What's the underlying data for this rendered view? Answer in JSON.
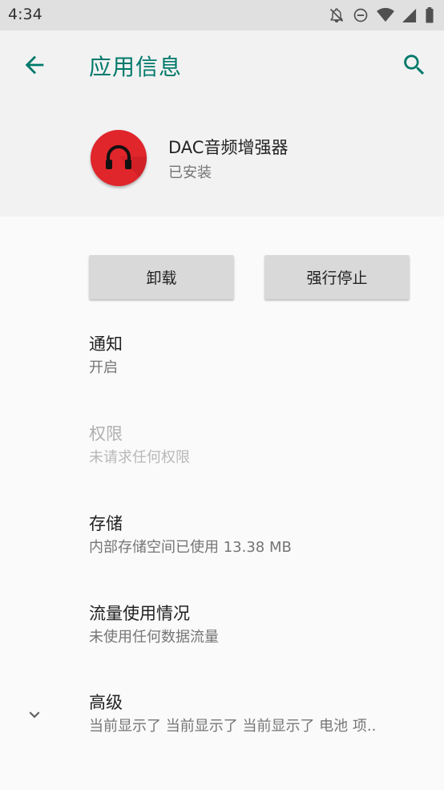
{
  "status_bar": {
    "time": "4:34",
    "icons": [
      "notifications-off-icon",
      "do-not-disturb-icon",
      "wifi-icon",
      "signal-icon",
      "battery-icon"
    ]
  },
  "header": {
    "title": "应用信息",
    "back_icon": "arrow-back-icon",
    "search_icon": "search-icon",
    "accent_color": "#00796b"
  },
  "app": {
    "name": "DAC音频增强器",
    "status": "已安装",
    "icon": "headphones-icon",
    "icon_color": "#e0252b"
  },
  "buttons": {
    "uninstall": "卸载",
    "force_stop": "强行停止"
  },
  "settings": [
    {
      "title": "通知",
      "summary": "开启",
      "enabled": true
    },
    {
      "title": "权限",
      "summary": "未请求任何权限",
      "enabled": false
    },
    {
      "title": "存储",
      "summary": "内部存储空间已使用 13.38 MB",
      "enabled": true
    },
    {
      "title": "流量使用情况",
      "summary": "未使用任何数据流量",
      "enabled": true
    },
    {
      "title": "高级",
      "summary": "当前显示了 当前显示了 当前显示了 电池 项..",
      "enabled": true
    }
  ]
}
